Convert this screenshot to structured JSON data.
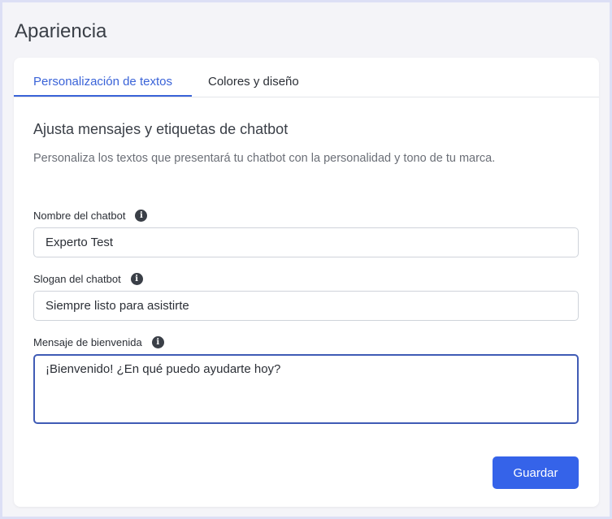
{
  "page": {
    "title": "Apariencia"
  },
  "tabs": [
    {
      "label": "Personalización de textos",
      "active": true
    },
    {
      "label": "Colores y diseño",
      "active": false
    }
  ],
  "section": {
    "heading": "Ajusta mensajes y etiquetas de chatbot",
    "description": "Personaliza los textos que presentará tu chatbot con la personalidad y tono de tu marca."
  },
  "fields": {
    "name": {
      "label": "Nombre del chatbot",
      "value": "Experto Test",
      "info_icon": "info-icon"
    },
    "slogan": {
      "label": "Slogan del chatbot",
      "value": "Siempre listo para asistirte",
      "info_icon": "info-icon"
    },
    "welcome": {
      "label": "Mensaje de bienvenida",
      "value": "¡Bienvenido! ¿En qué puedo ayudarte hoy?",
      "info_icon": "info-icon"
    }
  },
  "actions": {
    "save_label": "Guardar"
  },
  "colors": {
    "accent": "#3563e9",
    "tab_active": "#3a63d8",
    "focus_border": "#3f5bb5",
    "background": "#f4f4f8"
  }
}
